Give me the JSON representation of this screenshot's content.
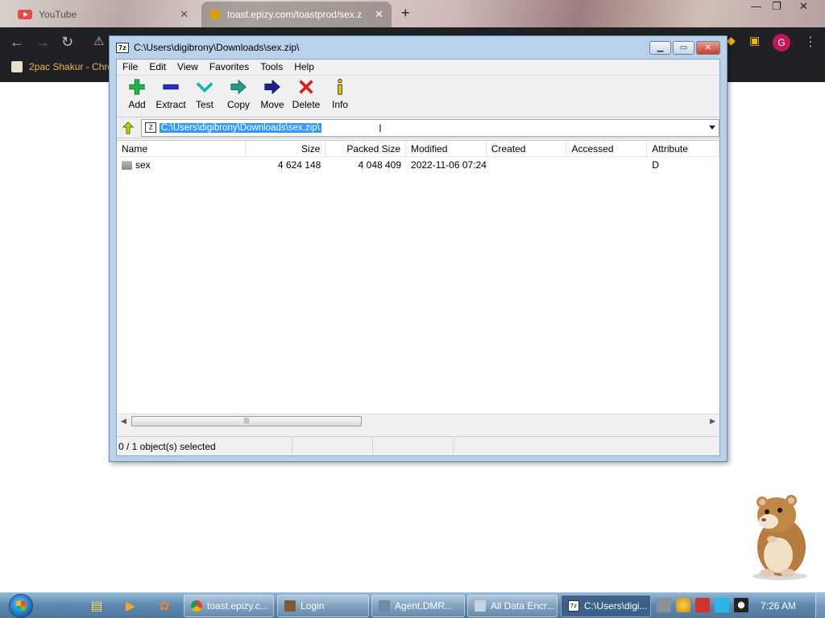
{
  "browser": {
    "tabs": [
      {
        "title": "YouTube",
        "close": "✕"
      },
      {
        "title": "toast.epizy.com/toastprod/sex.z",
        "close": "✕"
      }
    ],
    "new_tab": "+",
    "bookmark": "2pac Shakur - Chro",
    "avatar_letter": "G"
  },
  "zip_window": {
    "title": "C:\\Users\\digibrony\\Downloads\\sex.zip\\",
    "menus": [
      "File",
      "Edit",
      "View",
      "Favorites",
      "Tools",
      "Help"
    ],
    "tools": [
      {
        "label": "Add",
        "icon": "add-icon"
      },
      {
        "label": "Extract",
        "icon": "extract-icon"
      },
      {
        "label": "Test",
        "icon": "test-icon"
      },
      {
        "label": "Copy",
        "icon": "copy-icon"
      },
      {
        "label": "Move",
        "icon": "move-icon"
      },
      {
        "label": "Delete",
        "icon": "delete-icon"
      },
      {
        "label": "Info",
        "icon": "info-icon"
      }
    ],
    "address": "C:\\Users\\digibrony\\Downloads\\sex.zip\\",
    "columns": [
      "Name",
      "Size",
      "Packed Size",
      "Modified",
      "Created",
      "Accessed",
      "Attribute"
    ],
    "rows": [
      {
        "name": "sex",
        "size": "4 624 148",
        "packed": "4 048 409",
        "modified": "2022-11-06 07:24",
        "created": "",
        "accessed": "",
        "attribute": "D"
      }
    ],
    "status": "0 / 1 object(s) selected"
  },
  "taskbar": {
    "buttons": [
      {
        "label": "toast.epizy.c...",
        "color": "#e8b339"
      },
      {
        "label": "Login",
        "color": "#7b5a35"
      },
      {
        "label": "Agent.DMR...",
        "color": "#6f8aa8"
      },
      {
        "label": "All Data Encr...",
        "color": "#c9d3de"
      },
      {
        "label": "C:\\Users\\digi...",
        "color": "#333333"
      }
    ],
    "clock": "7:26 AM"
  }
}
